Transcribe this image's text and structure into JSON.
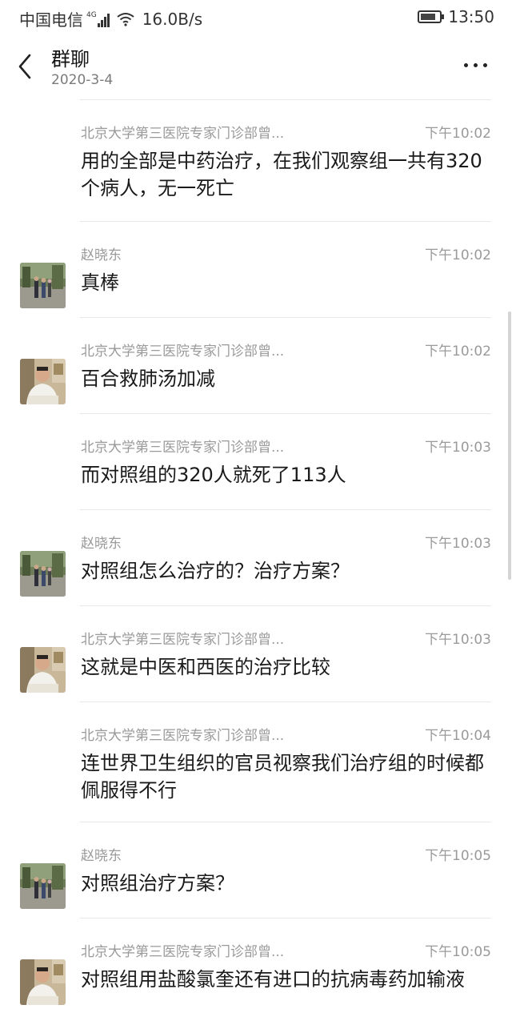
{
  "status": {
    "carrier": "中国电信",
    "network": "4G",
    "speed": "16.0B/s",
    "time": "13:50"
  },
  "header": {
    "title": "群聊",
    "subtitle": "2020-3-4",
    "back_icon": "chevron-left-icon",
    "more_icon": "more-icon"
  },
  "messages": [
    {
      "sender": "北京大学第三医院专家门诊部曾...",
      "time": "下午10:02",
      "text": "用的全部是中药治疗，在我们观察组一共有320个病人，无一死亡",
      "avatar": "none"
    },
    {
      "sender": "赵晓东",
      "time": "下午10:02",
      "text": "真棒",
      "avatar": "street-photo"
    },
    {
      "sender": "北京大学第三医院专家门诊部曾...",
      "time": "下午10:02",
      "text": "百合救肺汤加减",
      "avatar": "man-photo"
    },
    {
      "sender": "北京大学第三医院专家门诊部曾...",
      "time": "下午10:03",
      "text": "而对照组的320人就死了113人",
      "avatar": "none"
    },
    {
      "sender": "赵晓东",
      "time": "下午10:03",
      "text": "对照组怎么治疗的？治疗方案？",
      "avatar": "street-photo"
    },
    {
      "sender": "北京大学第三医院专家门诊部曾...",
      "time": "下午10:03",
      "text": "这就是中医和西医的治疗比较",
      "avatar": "man-photo"
    },
    {
      "sender": "北京大学第三医院专家门诊部曾...",
      "time": "下午10:04",
      "text": "连世界卫生组织的官员视察我们治疗组的时候都佩服得不行",
      "avatar": "none"
    },
    {
      "sender": "赵晓东",
      "time": "下午10:05",
      "text": "对照组治疗方案？",
      "avatar": "street-photo"
    },
    {
      "sender": "北京大学第三医院专家门诊部曾...",
      "time": "下午10:05",
      "text": "对照组用盐酸氯奎还有进口的抗病毒药加输液",
      "avatar": "man-photo"
    }
  ]
}
